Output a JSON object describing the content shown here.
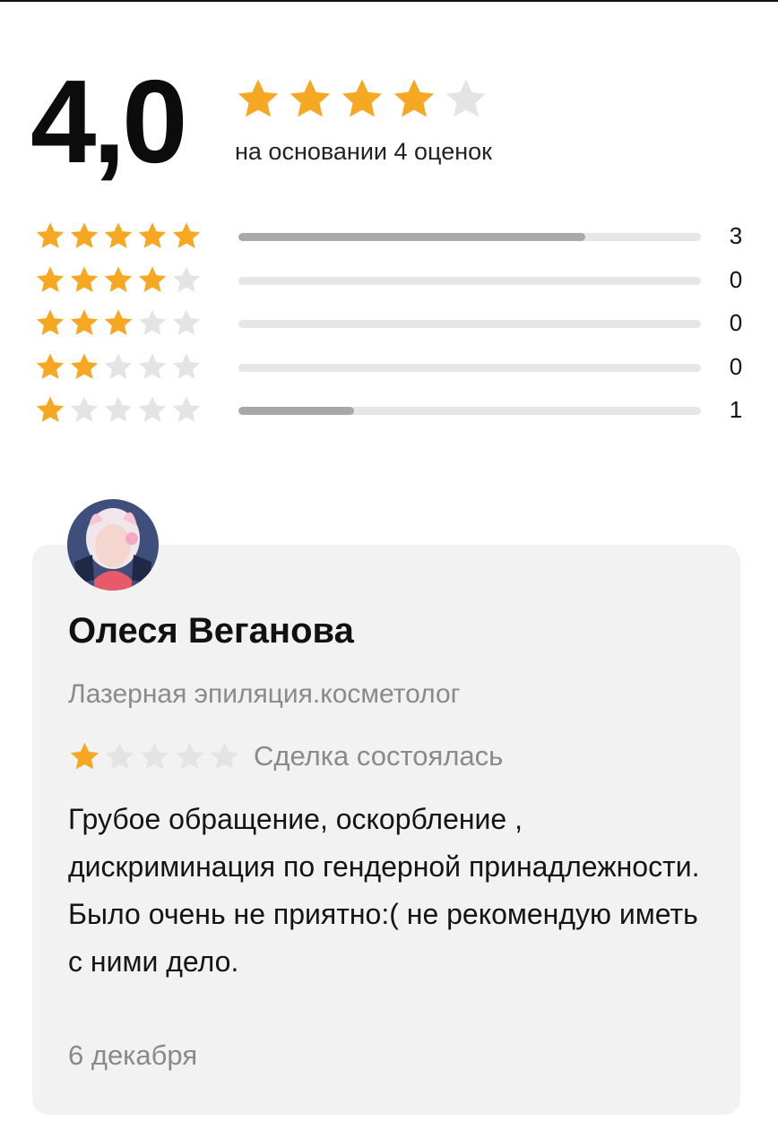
{
  "colors": {
    "star_filled": "#F7A823",
    "star_empty": "#E4E4E4",
    "bar_fill": "#A8A8A8",
    "bar_track": "#E6E6E6",
    "card_bg": "#F2F2F2"
  },
  "summary": {
    "score": "4,0",
    "stars_filled": 4,
    "stars_total": 5,
    "subtitle": "на основании 4 оценок"
  },
  "distribution": [
    {
      "stars": 5,
      "count": "3",
      "fraction": 0.75
    },
    {
      "stars": 4,
      "count": "0",
      "fraction": 0
    },
    {
      "stars": 3,
      "count": "0",
      "fraction": 0
    },
    {
      "stars": 2,
      "count": "0",
      "fraction": 0
    },
    {
      "stars": 1,
      "count": "1",
      "fraction": 0.25
    }
  ],
  "review": {
    "avatar_icon": "user-avatar-photo",
    "name": "Олеся Веганова",
    "service": "Лазерная эпиляция.косметолог",
    "rating": 1,
    "status": "Сделка состоялась",
    "text": "Грубое обращение, оскорбление , дискриминация по гендерной принадлежности. Было очень не приятно:( не рекомендую иметь с ними дело.",
    "date": "6 декабря"
  }
}
